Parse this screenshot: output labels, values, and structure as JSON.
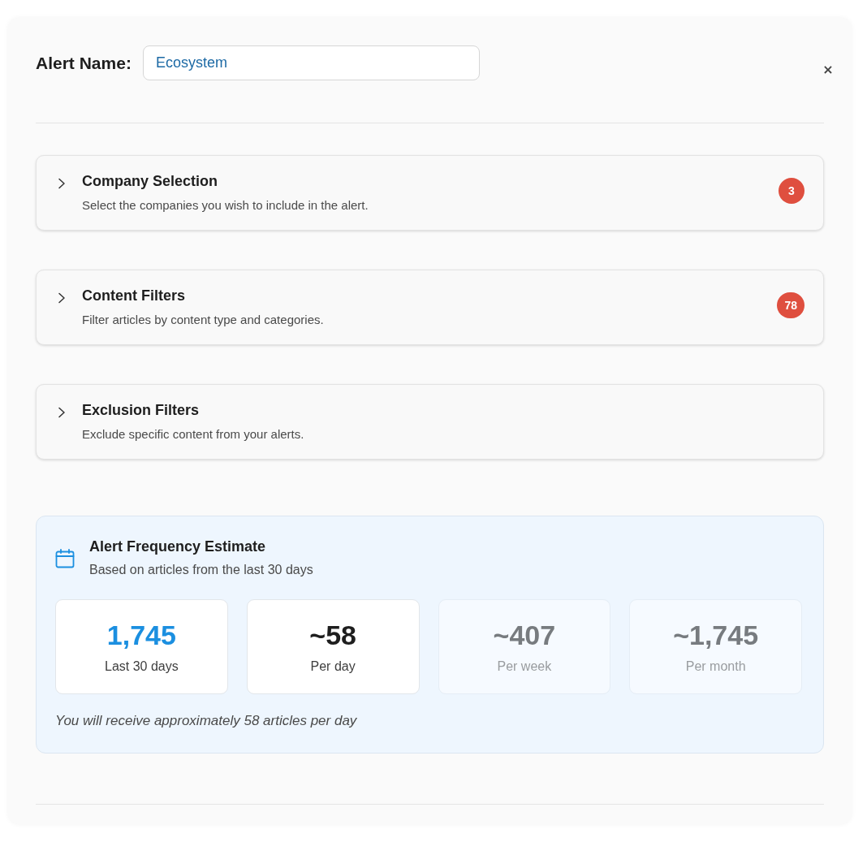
{
  "dialog": {
    "close": "×"
  },
  "alert_name": {
    "label": "Alert Name:",
    "value": "Ecosystem"
  },
  "sections": [
    {
      "title": "Company Selection",
      "description": "Select the companies you wish to include in the alert.",
      "badge": "3",
      "expanded": false
    },
    {
      "title": "Content Filters",
      "description": "Filter articles by content type and categories.",
      "badge": "78",
      "expanded": false
    },
    {
      "title": "Exclusion Filters",
      "description": "Exclude specific content from your alerts.",
      "expanded": false
    }
  ],
  "estimate": {
    "title": "Alert Frequency Estimate",
    "subtitle": "Based on articles from the last 30 days",
    "stats": [
      {
        "value": "1,745",
        "label": "Last 30 days",
        "kind": "accent"
      },
      {
        "value": "~58",
        "label": "Per day",
        "kind": "plain"
      },
      {
        "value": "~407",
        "label": "Per week",
        "kind": "dimmed"
      },
      {
        "value": "~1,745",
        "label": "Per month",
        "kind": "dimmed"
      }
    ],
    "note": "You will receive approximately 58 articles per day"
  }
}
